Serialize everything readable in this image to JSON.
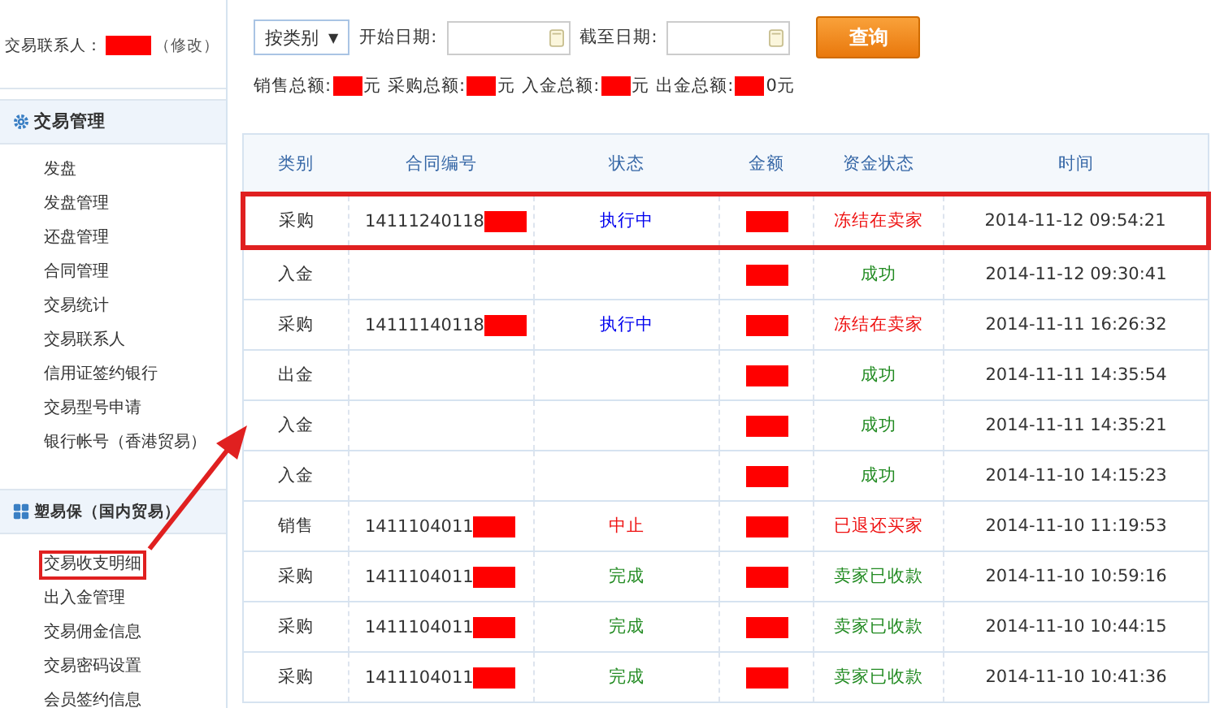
{
  "sidebar": {
    "contact_label": "交易联系人：",
    "contact_edit": "（修改）",
    "sections": [
      {
        "title": "交易管理",
        "items": [
          {
            "label": "发盘",
            "selected": false
          },
          {
            "label": "发盘管理",
            "selected": false
          },
          {
            "label": "还盘管理",
            "selected": false
          },
          {
            "label": "合同管理",
            "selected": false
          },
          {
            "label": "交易统计",
            "selected": false
          },
          {
            "label": "交易联系人",
            "selected": false
          },
          {
            "label": "信用证签约银行",
            "selected": false
          },
          {
            "label": "交易型号申请",
            "selected": false
          },
          {
            "label": "银行帐号（香港贸易）",
            "selected": false
          }
        ]
      },
      {
        "title": "塑易保（国内贸易）",
        "items": [
          {
            "label": "交易收支明细",
            "selected": true
          },
          {
            "label": "出入金管理",
            "selected": false
          },
          {
            "label": "交易佣金信息",
            "selected": false
          },
          {
            "label": "交易密码设置",
            "selected": false
          },
          {
            "label": "会员签约信息",
            "selected": false
          }
        ]
      }
    ]
  },
  "filter": {
    "category_select": "按类别",
    "caret": "▼",
    "start_label": "开始日期:",
    "end_label": "截至日期:",
    "search_button": "查询"
  },
  "totals": [
    {
      "label": "销售总额:",
      "suffix": "元"
    },
    {
      "label": "采购总额:",
      "suffix": "元"
    },
    {
      "label": "入金总额:",
      "suffix": "元"
    },
    {
      "label": "出金总额:",
      "suffix": "0元"
    }
  ],
  "table": {
    "columns": [
      "类别",
      "合同编号",
      "状态",
      "金额",
      "资金状态",
      "时间"
    ],
    "rows": [
      {
        "type": "采购",
        "contract": "14111240118",
        "status": {
          "text": "执行中",
          "kind": "active"
        },
        "fund_status": {
          "text": "冻结在卖家",
          "kind": "alert"
        },
        "time": "2014-11-12 09:54:21",
        "highlighted": true
      },
      {
        "type": "入金",
        "fund_status": {
          "text": "成功",
          "kind": "ok"
        },
        "time": "2014-11-12 09:30:41",
        "highlighted": false
      },
      {
        "type": "采购",
        "contract": "14111140118",
        "status": {
          "text": "执行中",
          "kind": "active"
        },
        "fund_status": {
          "text": "冻结在卖家",
          "kind": "alert"
        },
        "time": "2014-11-11 16:26:32",
        "highlighted": false
      },
      {
        "type": "出金",
        "fund_status": {
          "text": "成功",
          "kind": "ok"
        },
        "time": "2014-11-11 14:35:54",
        "highlighted": false
      },
      {
        "type": "入金",
        "fund_status": {
          "text": "成功",
          "kind": "ok"
        },
        "time": "2014-11-11 14:35:21",
        "highlighted": false
      },
      {
        "type": "入金",
        "fund_status": {
          "text": "成功",
          "kind": "ok"
        },
        "time": "2014-11-10 14:15:23",
        "highlighted": false
      },
      {
        "type": "销售",
        "contract": "1411104011",
        "status": {
          "text": "中止",
          "kind": "alert"
        },
        "fund_status": {
          "text": "已退还买家",
          "kind": "alert"
        },
        "time": "2014-11-10 11:19:53",
        "highlighted": false
      },
      {
        "type": "采购",
        "contract": "1411104011",
        "status": {
          "text": "完成",
          "kind": "ok"
        },
        "fund_status": {
          "text": "卖家已收款",
          "kind": "ok"
        },
        "time": "2014-11-10 10:59:16",
        "highlighted": false
      },
      {
        "type": "采购",
        "contract": "1411104011",
        "status": {
          "text": "完成",
          "kind": "ok"
        },
        "fund_status": {
          "text": "卖家已收款",
          "kind": "ok"
        },
        "time": "2014-11-10 10:44:15",
        "highlighted": false
      },
      {
        "type": "采购",
        "contract": "1411104011",
        "status": {
          "text": "完成",
          "kind": "ok"
        },
        "fund_status": {
          "text": "卖家已收款",
          "kind": "ok"
        },
        "time": "2014-11-10 10:41:36",
        "highlighted": false
      }
    ]
  }
}
